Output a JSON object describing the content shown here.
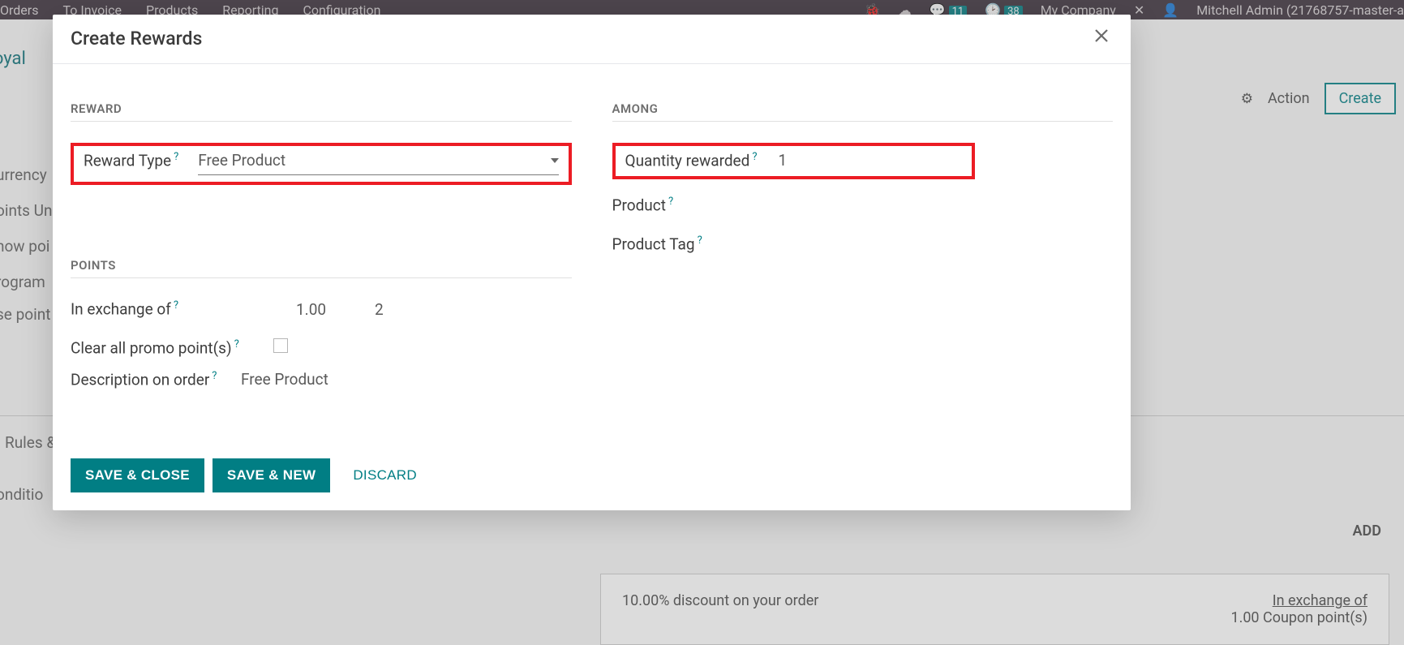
{
  "nav": {
    "left": [
      "Orders",
      "To Invoice",
      "Products",
      "Reporting",
      "Configuration"
    ],
    "msg_badge": "11",
    "clock_badge": "38",
    "company": "My Company",
    "user": "Mitchell Admin (21768757-master-a"
  },
  "background": {
    "loyal": "Loyal",
    "currency": "urrency",
    "points_un": "oints Un",
    "show_poi": "how poi",
    "program": "rogram",
    "se_point": "se point",
    "rules": "Rules &",
    "conditio": "onditio",
    "action_label": "Action",
    "create_label": "Create",
    "add_label": "ADD",
    "card_left": "10.00% discount on your order",
    "exchange_label": "In exchange of",
    "exchange_value": "1.00 Coupon point(s)"
  },
  "modal": {
    "title": "Create Rewards",
    "reward_heading": "REWARD",
    "among_heading": "AMONG",
    "reward_type_label": "Reward Type",
    "reward_type_value": "Free Product",
    "quantity_label": "Quantity rewarded",
    "quantity_value": "1",
    "product_label": "Product",
    "product_tag_label": "Product Tag",
    "points_heading": "POINTS",
    "in_exchange_label": "In exchange of",
    "in_exchange_value": "1.00",
    "in_exchange_value_2": "2",
    "clear_promo_label": "Clear all promo point(s)",
    "desc_label": "Description on order",
    "desc_value": "Free Product",
    "save_close": "SAVE & CLOSE",
    "save_new": "SAVE & NEW",
    "discard": "DISCARD"
  }
}
